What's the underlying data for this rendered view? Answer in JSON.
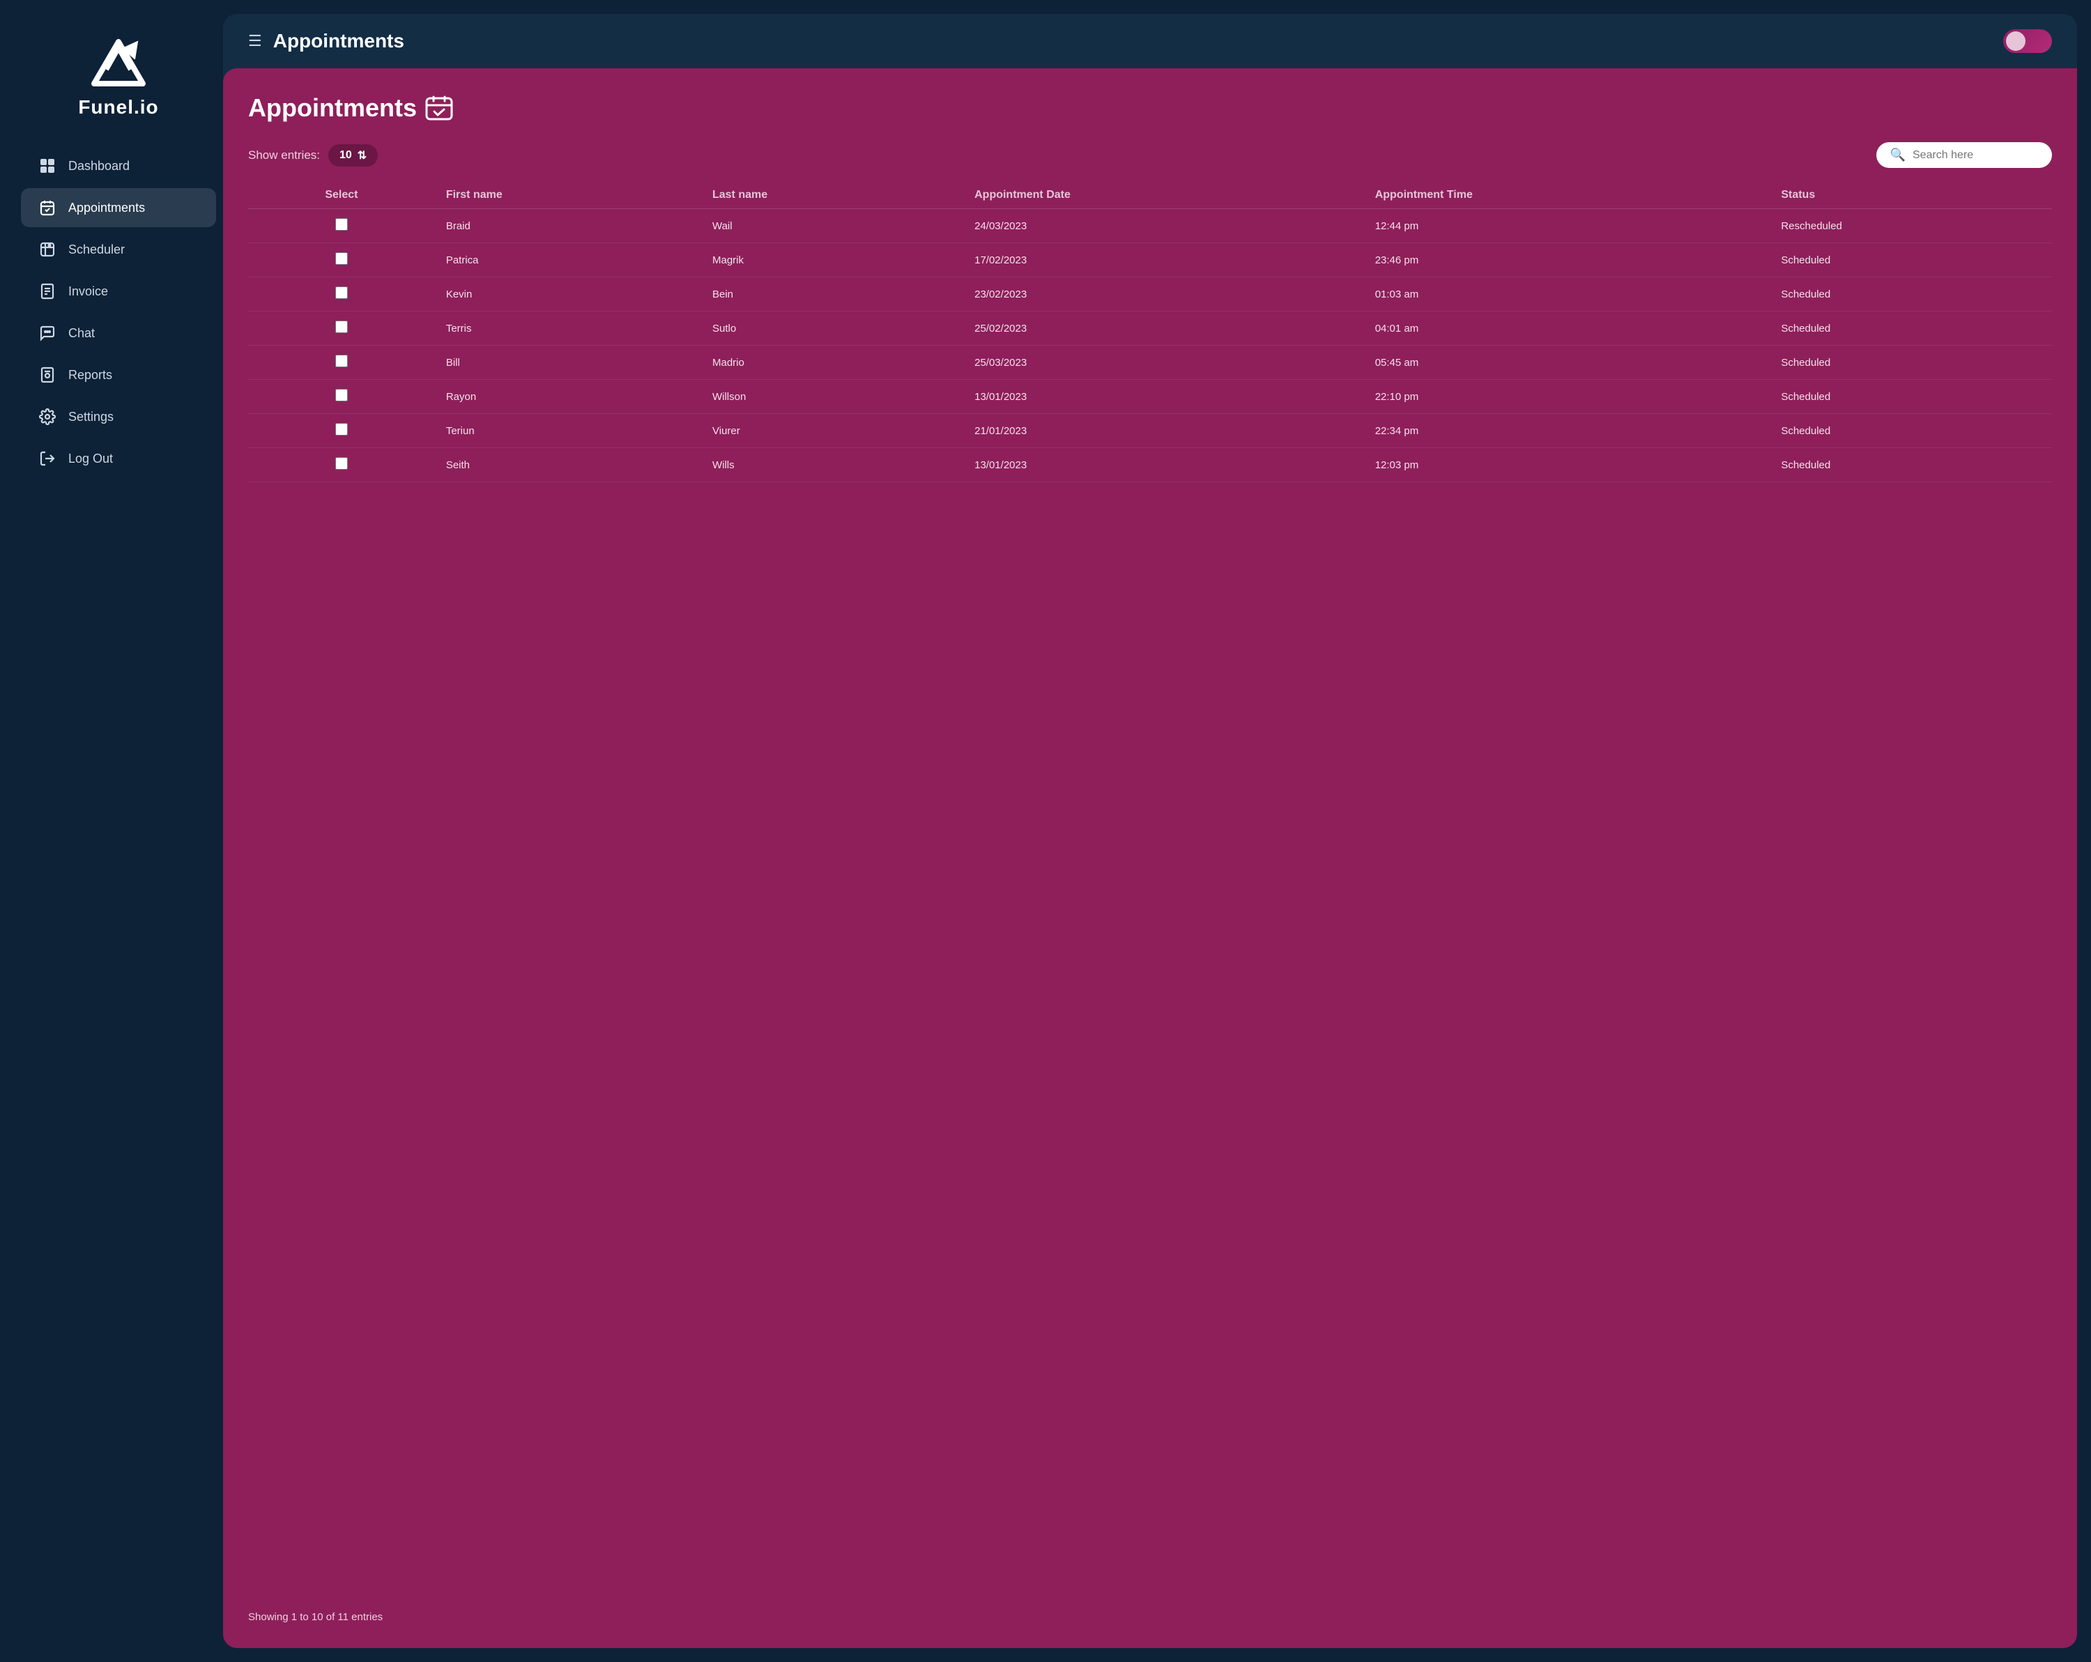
{
  "sidebar": {
    "logo": {
      "text": "Funel.io"
    },
    "nav_items": [
      {
        "id": "dashboard",
        "label": "Dashboard",
        "icon": "grid",
        "active": false
      },
      {
        "id": "appointments",
        "label": "Appointments",
        "icon": "calendar-check",
        "active": true
      },
      {
        "id": "scheduler",
        "label": "Scheduler",
        "icon": "scheduler",
        "active": false
      },
      {
        "id": "invoice",
        "label": "Invoice",
        "icon": "invoice",
        "active": false
      },
      {
        "id": "chat",
        "label": "Chat",
        "icon": "chat",
        "active": false
      },
      {
        "id": "reports",
        "label": "Reports",
        "icon": "reports",
        "active": false
      },
      {
        "id": "settings",
        "label": "Settings",
        "icon": "gear",
        "active": false
      },
      {
        "id": "logout",
        "label": "Log Out",
        "icon": "logout",
        "active": false
      }
    ]
  },
  "topbar": {
    "title": "Appointments",
    "toggle_state": "on"
  },
  "panel": {
    "title": "Appointments",
    "show_entries_label": "Show entries:",
    "entries_count": "10",
    "search_placeholder": "Search here",
    "table": {
      "columns": [
        "Select",
        "First name",
        "Last name",
        "Appointment Date",
        "Appointment Time",
        "Status"
      ],
      "rows": [
        {
          "first_name": "Braid",
          "last_name": "Wail",
          "date": "24/03/2023",
          "time": "12:44 pm",
          "status": "Rescheduled"
        },
        {
          "first_name": "Patrica",
          "last_name": "Magrik",
          "date": "17/02/2023",
          "time": "23:46 pm",
          "status": "Scheduled"
        },
        {
          "first_name": "Kevin",
          "last_name": "Bein",
          "date": "23/02/2023",
          "time": "01:03 am",
          "status": "Scheduled"
        },
        {
          "first_name": "Terris",
          "last_name": "Sutlo",
          "date": "25/02/2023",
          "time": "04:01 am",
          "status": "Scheduled"
        },
        {
          "first_name": "Bill",
          "last_name": "Madrio",
          "date": "25/03/2023",
          "time": "05:45 am",
          "status": "Scheduled"
        },
        {
          "first_name": "Rayon",
          "last_name": "Willson",
          "date": "13/01/2023",
          "time": "22:10 pm",
          "status": "Scheduled"
        },
        {
          "first_name": "Teriun",
          "last_name": "Viurer",
          "date": "21/01/2023",
          "time": "22:34 pm",
          "status": "Scheduled"
        },
        {
          "first_name": "Seith",
          "last_name": "Wills",
          "date": "13/01/2023",
          "time": "12:03 pm",
          "status": "Scheduled"
        }
      ]
    },
    "footer_text": "Showing 1 to 10 of 11 entries"
  }
}
